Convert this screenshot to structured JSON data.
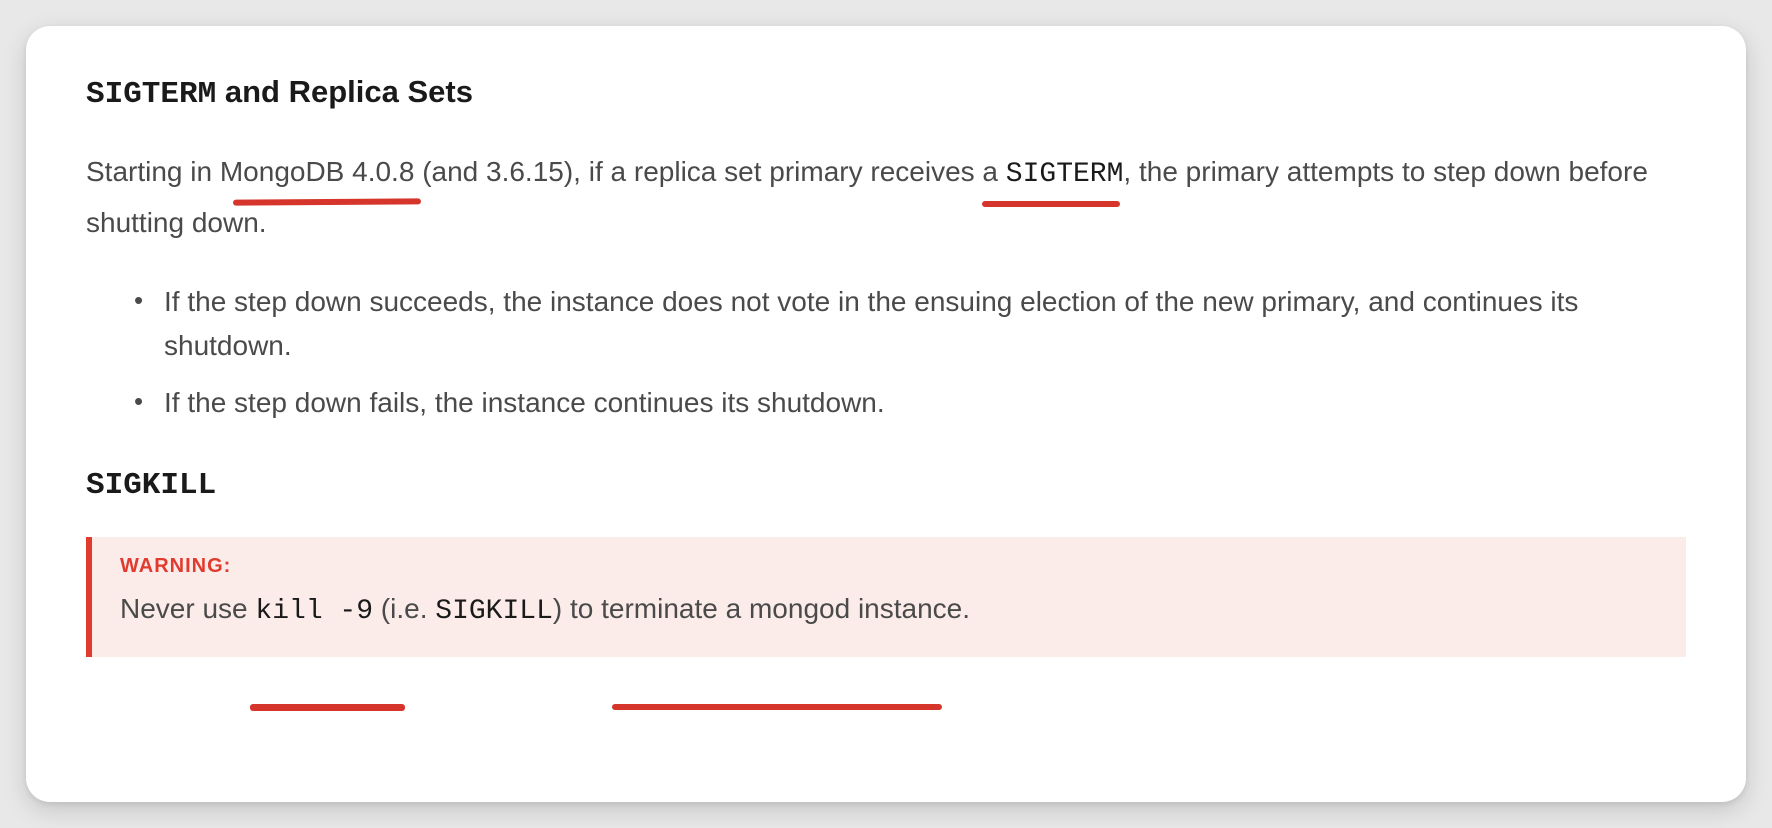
{
  "heading1_code": "SIGTERM",
  "heading1_rest": " and Replica Sets",
  "para1_part1": "Starting in MongoDB 4.0.8 (and 3.6.15), if a replica set primary receives a ",
  "para1_code": "SIGTERM",
  "para1_part2": ", the primary attempts to step down before shutting down.",
  "bullet1": "If the step down succeeds, the instance does not vote in the ensuing election of the new primary, and continues its shutdown.",
  "bullet2": "If the step down fails, the instance continues its shutdown.",
  "heading2": "SIGKILL",
  "warning_label": "WARNING:",
  "warning_part1": "Never use ",
  "warning_code1": "kill -9",
  "warning_part2": " (i.e. ",
  "warning_code2": "SIGKILL",
  "warning_part3": ") to terminate a mongod instance."
}
